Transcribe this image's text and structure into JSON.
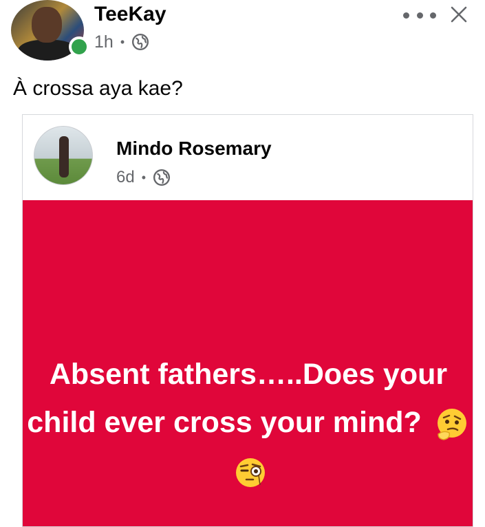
{
  "post": {
    "author": "TeeKay",
    "time": "1h",
    "separator": "•",
    "audience_icon": "globe-icon",
    "caption": "À crossa aya kae?",
    "online": true
  },
  "shared_post": {
    "author": "Mindo Rosemary",
    "time": "6d",
    "separator": "•",
    "audience_icon": "globe-icon",
    "text": "Absent fathers…..Does your child ever cross your mind?",
    "background_color": "#e0063a",
    "emojis": [
      "thinking-face-emoji",
      "face-with-monocle-emoji"
    ]
  },
  "icons": {
    "more": "more-horizontal-icon",
    "close": "close-icon"
  }
}
